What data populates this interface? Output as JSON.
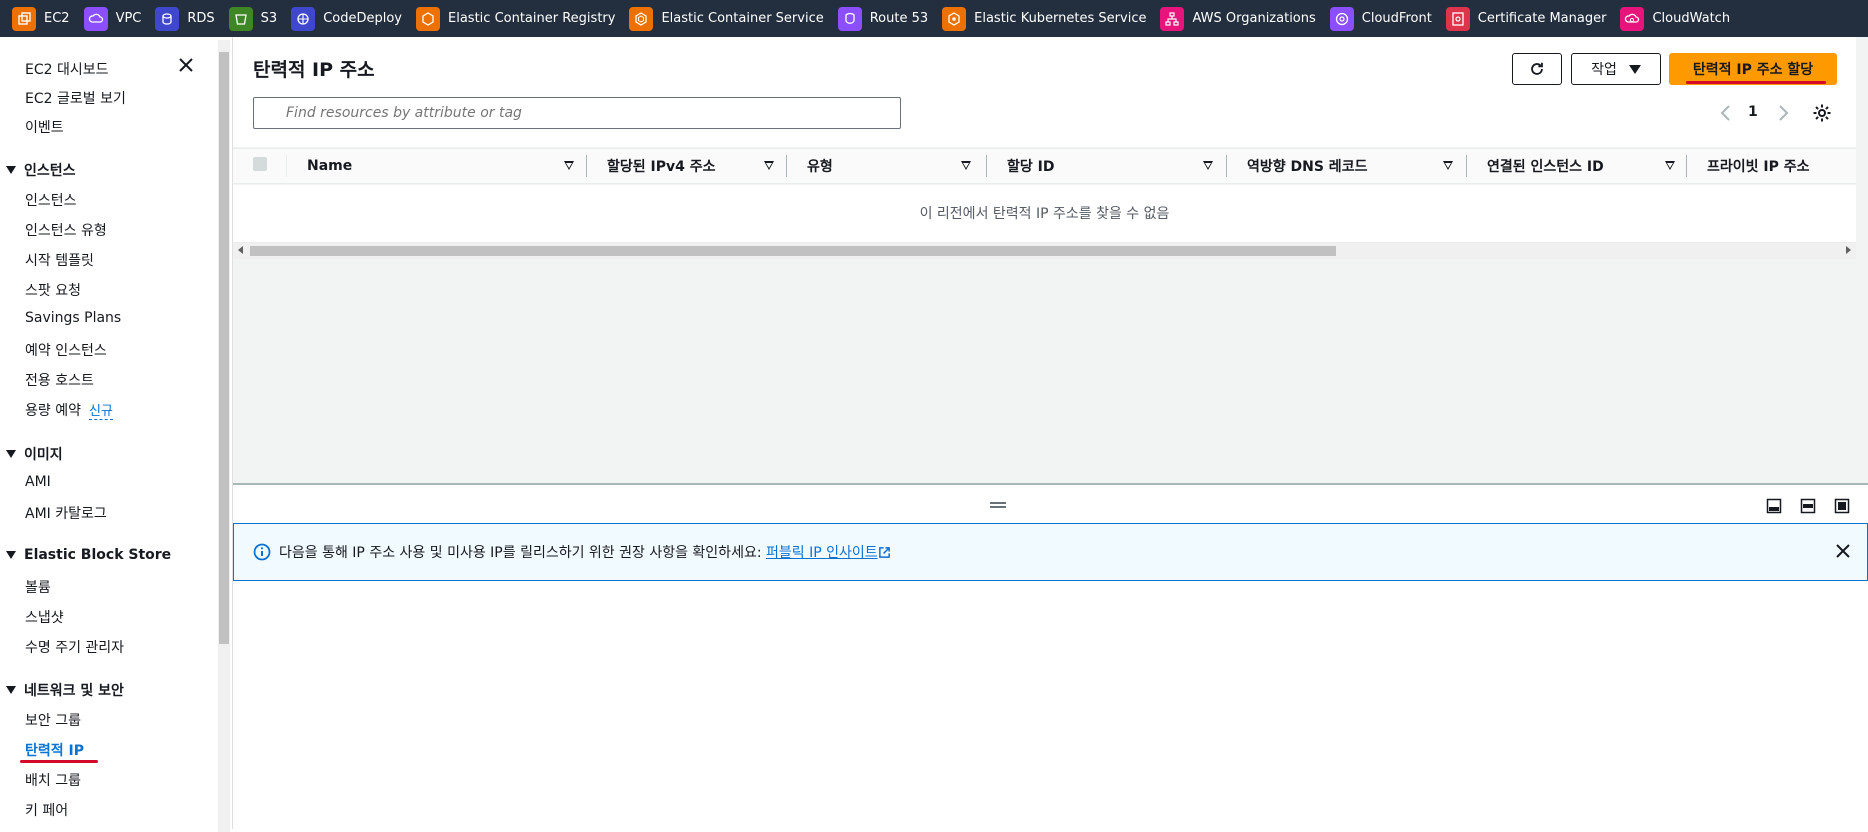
{
  "favorites": [
    {
      "label": "EC2",
      "color": "#ed7100",
      "icon": "ec2-icon"
    },
    {
      "label": "VPC",
      "color": "#8c4fff",
      "icon": "vpc-icon"
    },
    {
      "label": "RDS",
      "color": "#3f48cc",
      "icon": "rds-icon"
    },
    {
      "label": "S3",
      "color": "#3f8624",
      "icon": "s3-icon"
    },
    {
      "label": "CodeDeploy",
      "color": "#3f48cc",
      "icon": "codedeploy-icon"
    },
    {
      "label": "Elastic Container Registry",
      "color": "#ed7100",
      "icon": "ecr-icon"
    },
    {
      "label": "Elastic Container Service",
      "color": "#ed7100",
      "icon": "ecs-icon"
    },
    {
      "label": "Route 53",
      "color": "#8c4fff",
      "icon": "route53-icon"
    },
    {
      "label": "Elastic Kubernetes Service",
      "color": "#ed7100",
      "icon": "eks-icon"
    },
    {
      "label": "AWS Organizations",
      "color": "#e7157b",
      "icon": "organizations-icon"
    },
    {
      "label": "CloudFront",
      "color": "#8c4fff",
      "icon": "cloudfront-icon"
    },
    {
      "label": "Certificate Manager",
      "color": "#dd344c",
      "icon": "certificate-manager-icon"
    },
    {
      "label": "CloudWatch",
      "color": "#e7157b",
      "icon": "cloudwatch-icon"
    }
  ],
  "sidebar": {
    "top_items": [
      "EC2 대시보드",
      "EC2 글로벌 보기",
      "이벤트"
    ],
    "sections": [
      {
        "title": "인스턴스",
        "items": [
          "인스턴스",
          "인스턴스 유형",
          "시작 템플릿",
          "스팟 요청",
          "Savings Plans",
          "예약 인스턴스",
          "전용 호스트",
          "용량 예약"
        ]
      },
      {
        "title": "이미지",
        "items": [
          "AMI",
          "AMI 카탈로그"
        ]
      },
      {
        "title": "Elastic Block Store",
        "items": [
          "볼륨",
          "스냅샷",
          "수명 주기 관리자"
        ]
      },
      {
        "title": "네트워크 및 보안",
        "items": [
          "보안 그룹",
          "탄력적 IP",
          "배치 그룹",
          "키 페어"
        ]
      }
    ],
    "new_badge": "신규",
    "active_item": "탄력적 IP"
  },
  "page": {
    "title": "탄력적 IP 주소",
    "actions_label": "작업",
    "primary_label": "탄력적 IP 주소 할당",
    "search_placeholder": "Find resources by attribute or tag",
    "page_number": "1"
  },
  "table": {
    "columns": [
      "Name",
      "할당된 IPv4 주소",
      "유형",
      "할당 ID",
      "역방향 DNS 레코드",
      "연결된 인스턴스 ID",
      "프라이빗 IP 주소"
    ],
    "empty_message": "이 리전에서 탄력적 IP 주소를 찾을 수 없음"
  },
  "banner": {
    "text": "다음을 통해 IP 주소 사용 및 미사용 IP를 릴리스하기 위한 권장 사항을 확인하세요: ",
    "link": "퍼블릭 IP 인사이트"
  },
  "colors": {
    "primary": "#ff9900",
    "link": "#0972d3",
    "annotation": "#d40a2a",
    "topbar": "#232f3e"
  }
}
